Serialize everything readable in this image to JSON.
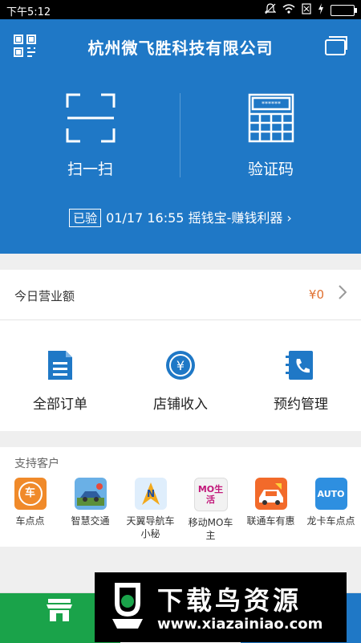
{
  "status_bar": {
    "time": "下午5:12"
  },
  "header": {
    "title": "杭州微飞胜科技有限公司",
    "scan_label": "扫一扫",
    "verify_label": "验证码",
    "verify_icon_text": "******",
    "last_record": {
      "badge": "已验",
      "text": "01/17 16:55 摇钱宝-赚钱利器 ›"
    }
  },
  "revenue": {
    "label": "今日营业额",
    "amount": "¥0"
  },
  "grid": [
    {
      "label": "全部订单"
    },
    {
      "label": "店铺收入"
    },
    {
      "label": "预约管理"
    }
  ],
  "customers": {
    "heading": "支持客户",
    "items": [
      {
        "name": "车点点",
        "logo_text": "车",
        "color": "#f08a2a"
      },
      {
        "name": "智慧交通",
        "logo_text": "",
        "color": "#6ab0e6"
      },
      {
        "name": "天翼导航车小秘",
        "name_line1": "天翼导航车",
        "name_line2": "小秘",
        "logo_text": "N",
        "color": "#dfeefc"
      },
      {
        "name": "移动MO车主",
        "name_line1": "移动MO车",
        "name_line2": "主",
        "logo_text": "MO生活",
        "color": "#f2f2f2"
      },
      {
        "name": "联通车有惠",
        "logo_text": "",
        "color": "#f26a2a"
      },
      {
        "name": "龙卡车点点",
        "logo_text": "AUTO",
        "color": "#2e8fe0"
      }
    ]
  },
  "tabbar": [
    {
      "label": "首页"
    },
    {
      "label": ""
    },
    {
      "label": ""
    }
  ],
  "watermark": {
    "title": "下载鸟资源",
    "url": "www.xiazainiao.com"
  },
  "colors": {
    "primary": "#1f78c6",
    "accent": "#1aa34a",
    "amount": "#e07030"
  }
}
